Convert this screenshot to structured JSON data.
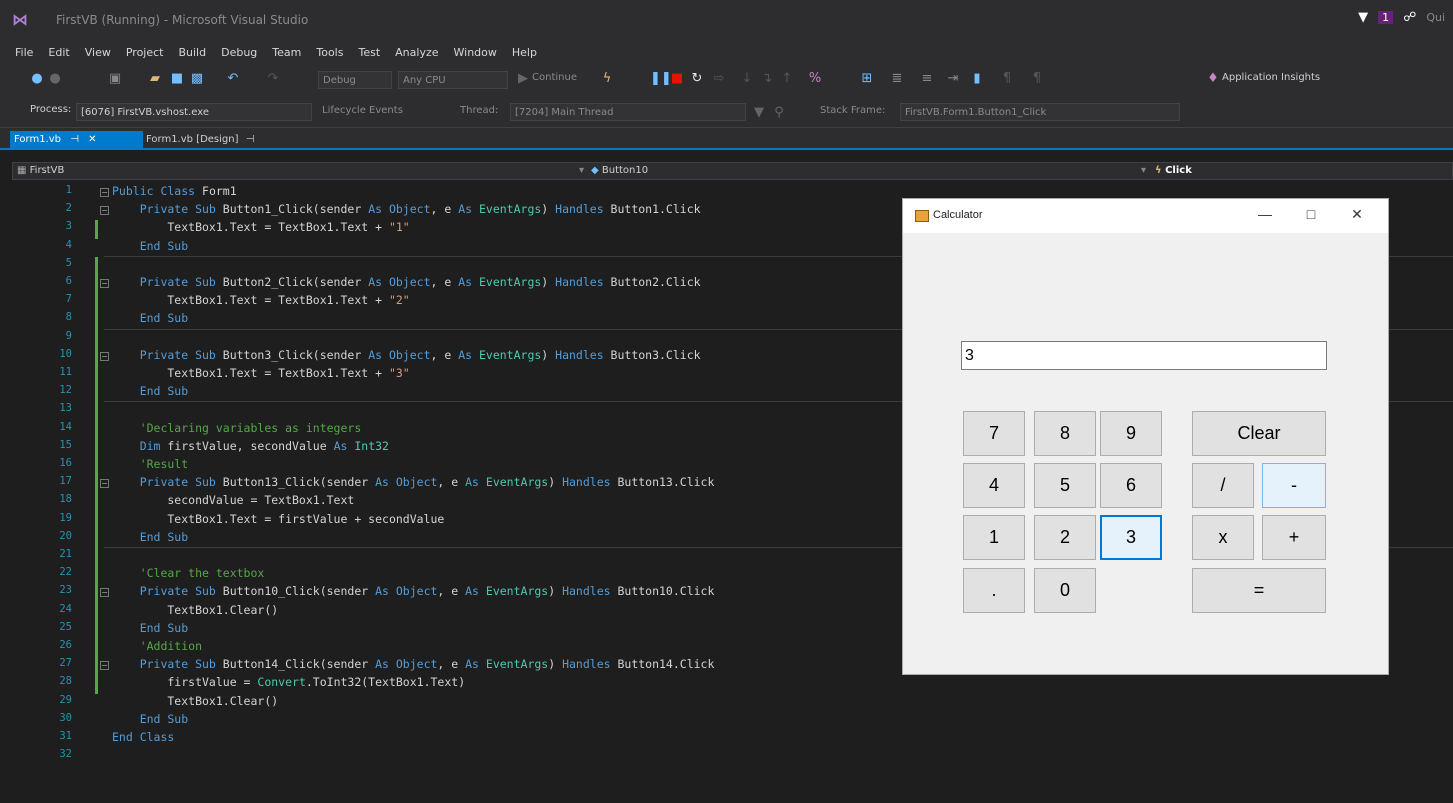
{
  "window": {
    "title": "FirstVB (Running) - Microsoft Visual Studio",
    "notifications": "1",
    "quick_launch": "Qui"
  },
  "menu": [
    "File",
    "Edit",
    "View",
    "Project",
    "Build",
    "Debug",
    "Team",
    "Tools",
    "Test",
    "Analyze",
    "Window",
    "Help"
  ],
  "toolbar": {
    "config": "Debug",
    "platform": "Any CPU",
    "continue_label": "Continue",
    "app_insights": "Application Insights"
  },
  "toolbar2": {
    "process_label": "Process:",
    "process_value": "[6076] FirstVB.vshost.exe",
    "lifecycle": "Lifecycle Events",
    "thread_label": "Thread:",
    "thread_value": "[7204] Main Thread",
    "stack_frame_label": "Stack Frame:",
    "stack_frame_value": "FirstVB.Form1.Button1_Click"
  },
  "tabs": [
    {
      "label": "Form1.vb"
    },
    {
      "label": "Form1.vb [Design]"
    }
  ],
  "navbar": {
    "project": "FirstVB",
    "object": "Button10",
    "event": "Click"
  },
  "code": [
    {
      "n": "1",
      "segs": [
        {
          "t": "Public Class ",
          "c": "kw"
        },
        {
          "t": "Form1",
          "c": ""
        }
      ]
    },
    {
      "n": "2",
      "segs": [
        {
          "t": "    Private Sub ",
          "c": "kw"
        },
        {
          "t": "Button1_Click(sender ",
          "c": ""
        },
        {
          "t": "As Object",
          "c": "kw"
        },
        {
          "t": ", e ",
          "c": ""
        },
        {
          "t": "As ",
          "c": "kw"
        },
        {
          "t": "EventArgs",
          "c": "ty"
        },
        {
          "t": ") ",
          "c": ""
        },
        {
          "t": "Handles ",
          "c": "kw"
        },
        {
          "t": "Button1.Click",
          "c": ""
        }
      ]
    },
    {
      "n": "3",
      "segs": [
        {
          "t": "        TextBox1.Text = TextBox1.Text + ",
          "c": ""
        },
        {
          "t": "\"1\"",
          "c": "str"
        }
      ]
    },
    {
      "n": "4",
      "segs": [
        {
          "t": "    End Sub",
          "c": "kw"
        }
      ]
    },
    {
      "n": "5",
      "segs": []
    },
    {
      "n": "6",
      "segs": [
        {
          "t": "    Private Sub ",
          "c": "kw"
        },
        {
          "t": "Button2_Click(sender ",
          "c": ""
        },
        {
          "t": "As Object",
          "c": "kw"
        },
        {
          "t": ", e ",
          "c": ""
        },
        {
          "t": "As ",
          "c": "kw"
        },
        {
          "t": "EventArgs",
          "c": "ty"
        },
        {
          "t": ") ",
          "c": ""
        },
        {
          "t": "Handles ",
          "c": "kw"
        },
        {
          "t": "Button2.Click",
          "c": ""
        }
      ]
    },
    {
      "n": "7",
      "segs": [
        {
          "t": "        TextBox1.Text = TextBox1.Text + ",
          "c": ""
        },
        {
          "t": "\"2\"",
          "c": "str"
        }
      ]
    },
    {
      "n": "8",
      "segs": [
        {
          "t": "    End Sub",
          "c": "kw"
        }
      ]
    },
    {
      "n": "9",
      "segs": []
    },
    {
      "n": "10",
      "segs": [
        {
          "t": "    Private Sub ",
          "c": "kw"
        },
        {
          "t": "Button3_Click(sender ",
          "c": ""
        },
        {
          "t": "As Object",
          "c": "kw"
        },
        {
          "t": ", e ",
          "c": ""
        },
        {
          "t": "As ",
          "c": "kw"
        },
        {
          "t": "EventArgs",
          "c": "ty"
        },
        {
          "t": ") ",
          "c": ""
        },
        {
          "t": "Handles ",
          "c": "kw"
        },
        {
          "t": "Button3.Click",
          "c": ""
        }
      ]
    },
    {
      "n": "11",
      "segs": [
        {
          "t": "        TextBox1.Text = TextBox1.Text + ",
          "c": ""
        },
        {
          "t": "\"3\"",
          "c": "str"
        }
      ]
    },
    {
      "n": "12",
      "segs": [
        {
          "t": "    End Sub",
          "c": "kw"
        }
      ]
    },
    {
      "n": "13",
      "segs": []
    },
    {
      "n": "14",
      "segs": [
        {
          "t": "    'Declaring variables as integers",
          "c": "cm"
        }
      ]
    },
    {
      "n": "15",
      "segs": [
        {
          "t": "    Dim ",
          "c": "kw"
        },
        {
          "t": "firstValue, secondValue ",
          "c": ""
        },
        {
          "t": "As ",
          "c": "kw"
        },
        {
          "t": "Int32",
          "c": "ty"
        }
      ]
    },
    {
      "n": "16",
      "segs": [
        {
          "t": "    'Result",
          "c": "cm"
        }
      ]
    },
    {
      "n": "17",
      "segs": [
        {
          "t": "    Private Sub ",
          "c": "kw"
        },
        {
          "t": "Button13_Click(sender ",
          "c": ""
        },
        {
          "t": "As Object",
          "c": "kw"
        },
        {
          "t": ", e ",
          "c": ""
        },
        {
          "t": "As ",
          "c": "kw"
        },
        {
          "t": "EventArgs",
          "c": "ty"
        },
        {
          "t": ") ",
          "c": ""
        },
        {
          "t": "Handles ",
          "c": "kw"
        },
        {
          "t": "Button13.Click",
          "c": ""
        }
      ]
    },
    {
      "n": "18",
      "segs": [
        {
          "t": "        secondValue = TextBox1.Text",
          "c": ""
        }
      ]
    },
    {
      "n": "19",
      "segs": [
        {
          "t": "        TextBox1.Text = firstValue + secondValue",
          "c": ""
        }
      ]
    },
    {
      "n": "20",
      "segs": [
        {
          "t": "    End Sub",
          "c": "kw"
        }
      ]
    },
    {
      "n": "21",
      "segs": []
    },
    {
      "n": "22",
      "segs": [
        {
          "t": "    'Clear the textbox",
          "c": "cm"
        }
      ]
    },
    {
      "n": "23",
      "segs": [
        {
          "t": "    Private Sub ",
          "c": "kw"
        },
        {
          "t": "Button10_Click(sender ",
          "c": ""
        },
        {
          "t": "As Object",
          "c": "kw"
        },
        {
          "t": ", e ",
          "c": ""
        },
        {
          "t": "As ",
          "c": "kw"
        },
        {
          "t": "EventArgs",
          "c": "ty"
        },
        {
          "t": ") ",
          "c": ""
        },
        {
          "t": "Handles ",
          "c": "kw"
        },
        {
          "t": "Button10.Click",
          "c": ""
        }
      ]
    },
    {
      "n": "24",
      "segs": [
        {
          "t": "        TextBox1.Clear()",
          "c": ""
        }
      ]
    },
    {
      "n": "25",
      "segs": [
        {
          "t": "    End Sub",
          "c": "kw"
        }
      ]
    },
    {
      "n": "26",
      "segs": [
        {
          "t": "    'Addition",
          "c": "cm"
        }
      ]
    },
    {
      "n": "27",
      "segs": [
        {
          "t": "    Private Sub ",
          "c": "kw"
        },
        {
          "t": "Button14_Click(sender ",
          "c": ""
        },
        {
          "t": "As Object",
          "c": "kw"
        },
        {
          "t": ", e ",
          "c": ""
        },
        {
          "t": "As ",
          "c": "kw"
        },
        {
          "t": "EventArgs",
          "c": "ty"
        },
        {
          "t": ") ",
          "c": ""
        },
        {
          "t": "Handles ",
          "c": "kw"
        },
        {
          "t": "Button14.Click",
          "c": ""
        }
      ]
    },
    {
      "n": "28",
      "segs": [
        {
          "t": "        firstValue = ",
          "c": ""
        },
        {
          "t": "Convert",
          "c": "ty"
        },
        {
          "t": ".ToInt32(TextBox1.Text)",
          "c": ""
        }
      ]
    },
    {
      "n": "29",
      "segs": [
        {
          "t": "        TextBox1.Clear()",
          "c": ""
        }
      ]
    },
    {
      "n": "30",
      "segs": [
        {
          "t": "    End Sub",
          "c": "kw"
        }
      ]
    },
    {
      "n": "31",
      "segs": [
        {
          "t": "End Class",
          "c": "kw"
        }
      ]
    },
    {
      "n": "32",
      "segs": []
    }
  ],
  "calculator": {
    "title": "Calculator",
    "display_value": "3",
    "buttons": {
      "b7": "7",
      "b8": "8",
      "b9": "9",
      "clear": "Clear",
      "b4": "4",
      "b5": "5",
      "b6": "6",
      "div": "/",
      "minus": "-",
      "b1": "1",
      "b2": "2",
      "b3": "3",
      "mul": "x",
      "plus": "+",
      "dot": ".",
      "b0": "0",
      "eq": "="
    }
  }
}
